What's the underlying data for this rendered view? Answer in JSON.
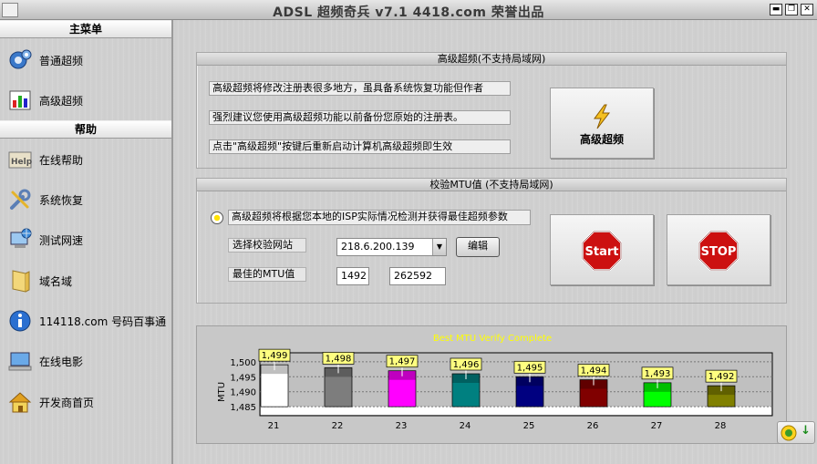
{
  "window": {
    "title": "ADSL 超频奇兵 v7.1 4418.com 荣誉出品",
    "minimize_glyph": "▬",
    "restore_glyph": "❐",
    "close_glyph": "✕"
  },
  "sidebar": {
    "main_menu_header": "主菜单",
    "main_items": [
      {
        "label": "普通超频",
        "icon": "gear-icon"
      },
      {
        "label": "高级超频",
        "icon": "chart-icon"
      }
    ],
    "help_header": "帮助",
    "help_items": [
      {
        "label": "在线帮助",
        "icon": "help-book-icon"
      },
      {
        "label": "系统恢复",
        "icon": "wrench-icon"
      },
      {
        "label": "测试网速",
        "icon": "network-computer-icon"
      },
      {
        "label": "域名域",
        "icon": "book-icon"
      },
      {
        "label": "114118.com 号码百事通",
        "icon": "info-icon"
      },
      {
        "label": "在线电影",
        "icon": "computer-movie-icon"
      },
      {
        "label": "开发商首页",
        "icon": "home-icon"
      }
    ]
  },
  "advanced": {
    "header": "高级超频(不支持局域网)",
    "lines": [
      "高级超频将修改注册表很多地方，虽具备系统恢复功能但作者",
      "强烈建议您使用高级超频功能以前备份您原始的注册表。",
      "点击\"高级超频\"按键后重新启动计算机高级超频即生效"
    ],
    "button_label": "高级超频"
  },
  "mtu": {
    "header": "校验MTU值 (不支持局域网)",
    "radio_label": "高级超频将根据您本地的ISP实际情况检测并获得最佳超频参数",
    "site_label": "选择校验网站",
    "site_value": "218.6.200.139",
    "edit_button": "编辑",
    "best_label": "最佳的MTU值",
    "best_mtu": "1492",
    "best_extra": "262592",
    "start_label": "Start",
    "stop_label": "STOP"
  },
  "chart_data": {
    "type": "bar",
    "title": "Best MTU Verify Complete",
    "ylabel": "MTU",
    "categories": [
      "21",
      "22",
      "23",
      "24",
      "25",
      "26",
      "27",
      "28"
    ],
    "values": [
      1499,
      1498,
      1497,
      1496,
      1495,
      1494,
      1493,
      1492
    ],
    "data_labels": [
      "1,499",
      "1,498",
      "1,497",
      "1,496",
      "1,495",
      "1,494",
      "1,493",
      "1,492"
    ],
    "bar_colors": [
      "#ffffff",
      "#7d7d7d",
      "#ff00ff",
      "#008080",
      "#000080",
      "#800000",
      "#00ff00",
      "#808000"
    ],
    "yticks": [
      "1,500",
      "1,495",
      "1,490",
      "1,485"
    ],
    "ylim": [
      1482,
      1503
    ]
  },
  "tray": {
    "download_glyph": "↓"
  }
}
